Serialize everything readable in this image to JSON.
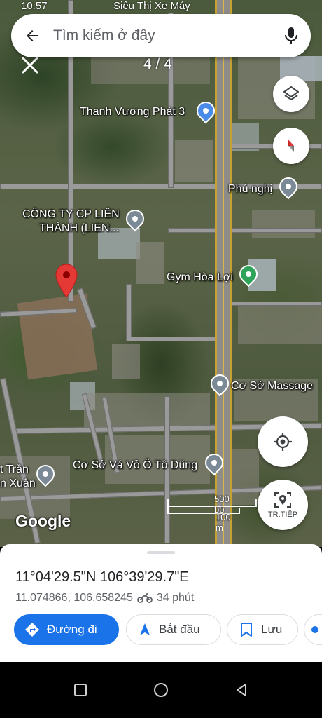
{
  "status_peek": {
    "time": "10:57",
    "top_label": "Siêu Thị Xe Máy"
  },
  "search": {
    "placeholder": "Tìm kiếm ở đây"
  },
  "photo_counter": "4 / 4",
  "map_labels": {
    "thanh_vuong": "Thanh Vương Phát 3",
    "phu_nghi": "Phú nghị",
    "cty_line1": "CÔNG TY CP LIÊN",
    "cty_line2": "THÀNH (LIEN...",
    "gym": "Gym Hòa Lợi",
    "massage": "Cơ Sở Massage",
    "tire": "Cơ Sở Vá Vỏ Ô Tô Dũng",
    "tran_line1": "t Trần",
    "tran_line2": "n Xuân"
  },
  "scale": {
    "imperial": "500 bộ",
    "metric": "100 m"
  },
  "tt_button": "TR.TIẾP",
  "google_logo": "Google",
  "place": {
    "coords_dms": "11°04'29.5\"N 106°39'29.7\"E",
    "coords_decimal": "11.074866, 106.658245",
    "travel_time": "34 phút"
  },
  "actions": {
    "directions": "Đường đi",
    "start": "Bắt đầu",
    "save": "Lưu"
  },
  "colors": {
    "accent": "#1a73e8",
    "pin_red": "#e53935",
    "highway": "#c7a233"
  }
}
